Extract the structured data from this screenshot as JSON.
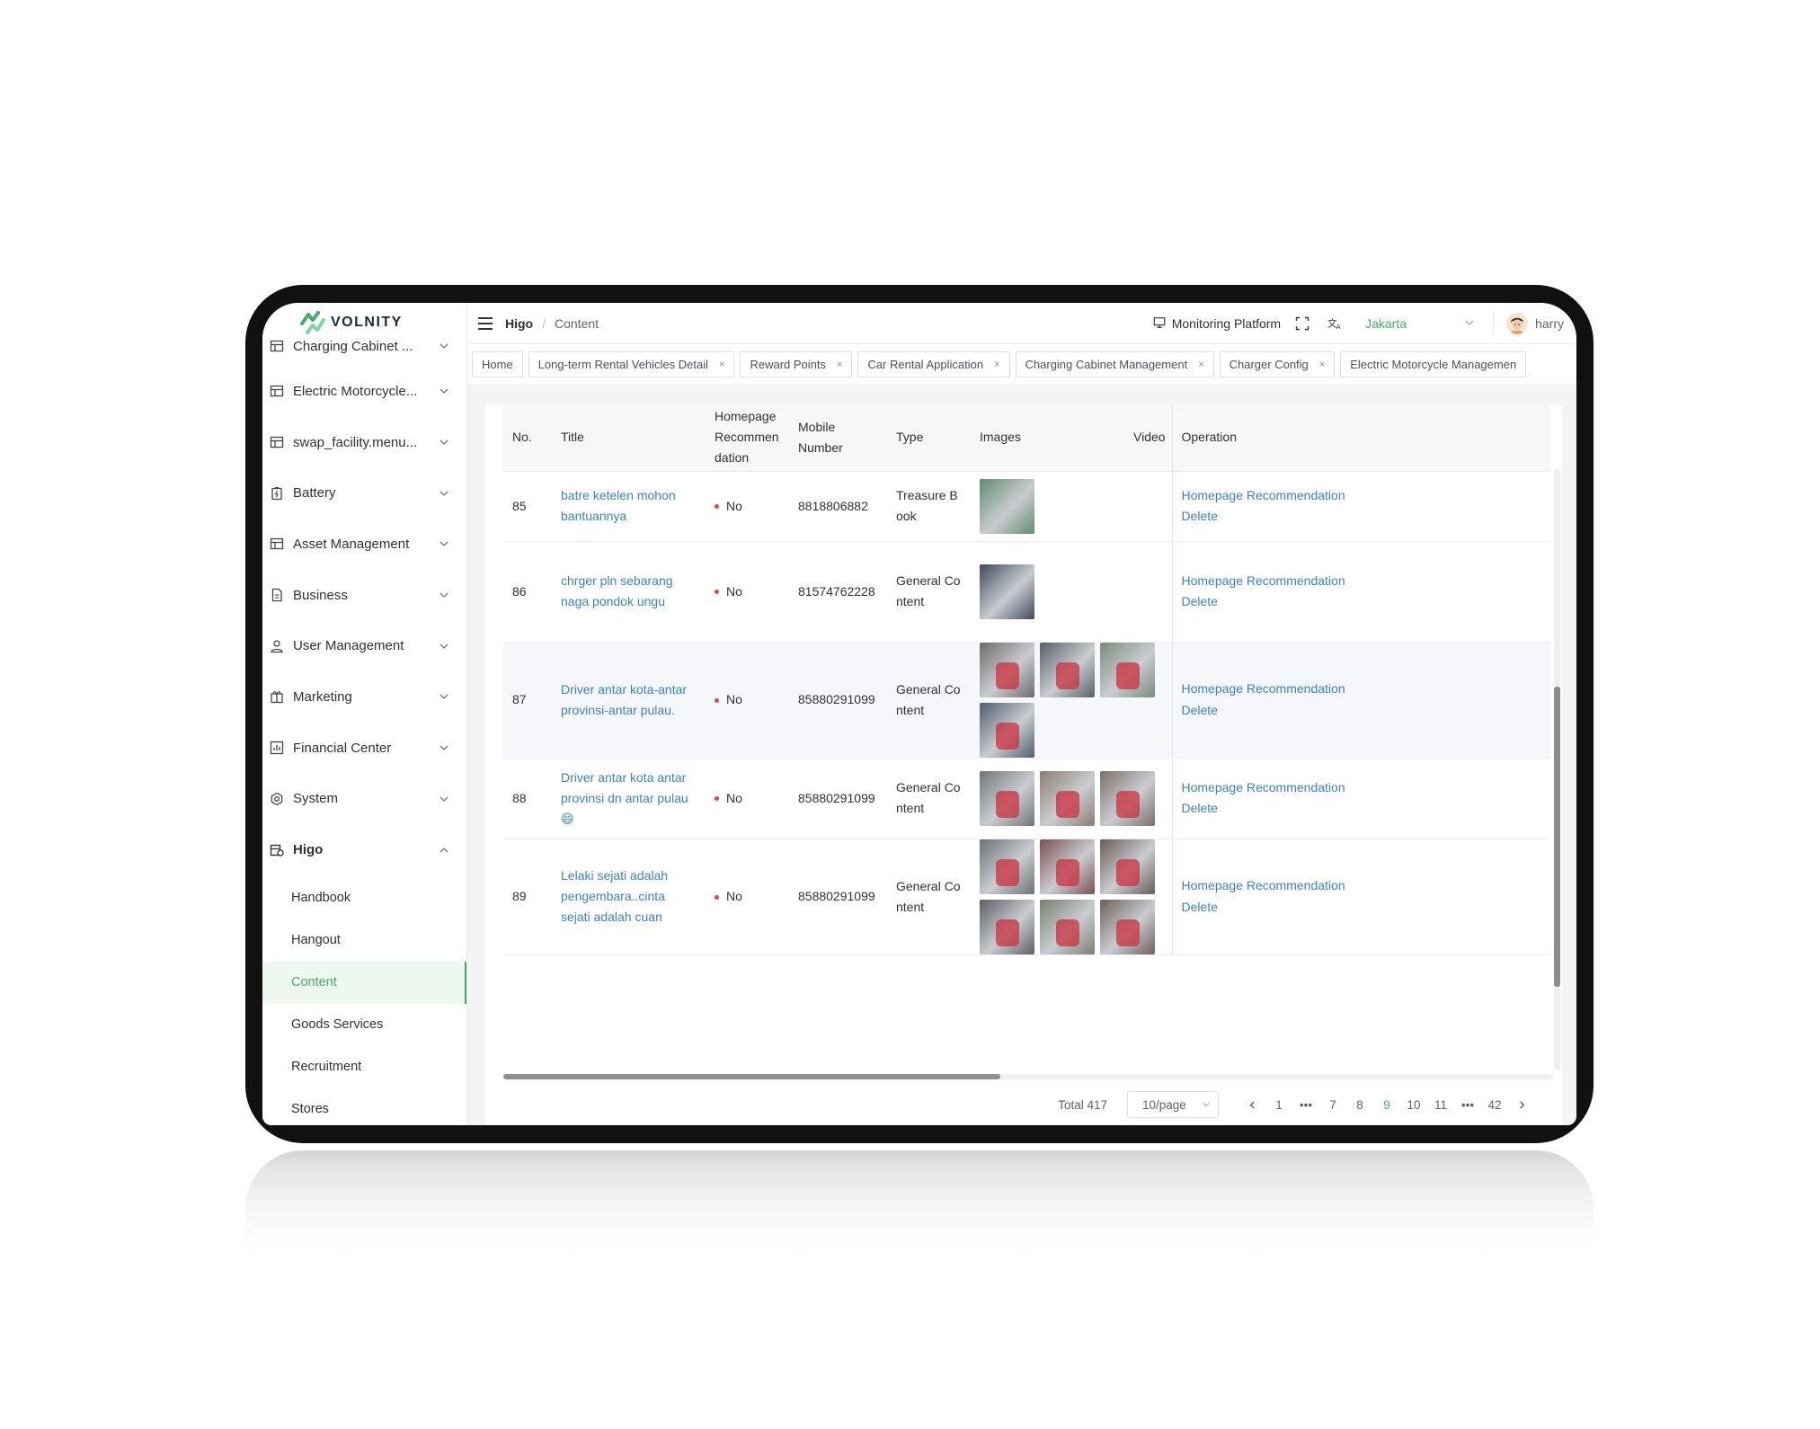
{
  "app": {
    "logo_text": "VOLNITY",
    "brand_color": "#3fae69",
    "link_color": "#3b82c4"
  },
  "sidebar": {
    "items": [
      {
        "label": "Charging Cabinet ...",
        "icon": "grid-icon"
      },
      {
        "label": "Electric Motorcycle...",
        "icon": "grid-icon"
      },
      {
        "label": "swap_facility.menu...",
        "icon": "grid-icon"
      },
      {
        "label": "Battery",
        "icon": "battery-icon"
      },
      {
        "label": "Asset Management",
        "icon": "grid-icon"
      },
      {
        "label": "Business",
        "icon": "document-icon"
      },
      {
        "label": "User Management",
        "icon": "user-icon"
      },
      {
        "label": "Marketing",
        "icon": "gift-icon"
      },
      {
        "label": "Financial Center",
        "icon": "chart-icon"
      },
      {
        "label": "System",
        "icon": "settings-icon"
      },
      {
        "label": "Higo",
        "icon": "higo-icon"
      }
    ],
    "higo_children": [
      "Handbook",
      "Hangout",
      "Content",
      "Goods Services",
      "Recruitment",
      "Stores"
    ],
    "active_child": "Content"
  },
  "topbar": {
    "breadcrumb": [
      "Higo",
      "Content"
    ],
    "monitoring": "Monitoring Platform",
    "city": "Jakarta",
    "user": "harry"
  },
  "tags": [
    {
      "label": "Home",
      "closable": false
    },
    {
      "label": "Long-term Rental Vehicles Detail",
      "closable": true
    },
    {
      "label": "Reward Points",
      "closable": true
    },
    {
      "label": "Car Rental Application",
      "closable": true
    },
    {
      "label": "Charging Cabinet Management",
      "closable": true
    },
    {
      "label": "Charger Config",
      "closable": true
    },
    {
      "label": "Electric Motorcycle Managemen",
      "closable": false
    }
  ],
  "table": {
    "columns": {
      "no": "No.",
      "title": "Title",
      "homepage": "Homepage Recommendation",
      "mobile": "Mobile Number",
      "type": "Type",
      "images": "Images",
      "video": "Video",
      "operation": "Operation"
    },
    "operations": [
      "Homepage Recommendation",
      "Delete"
    ],
    "rows": [
      {
        "no": "85",
        "title": "batre ketelen mohon bantuannya",
        "homepage": "No",
        "mobile": "8818806882",
        "type": "Treasure Book",
        "images": [
          "#5f8c6e"
        ]
      },
      {
        "no": "86",
        "title": "chrger pln sebarang naga pondok ungu",
        "homepage": "No",
        "mobile": "81574762228",
        "type": "General Content",
        "images": [
          "#3e4a5c"
        ]
      },
      {
        "no": "87",
        "title": "Driver antar kota-antar provinsi-antar pulau.",
        "homepage": "No",
        "mobile": "85880291099",
        "type": "General Content",
        "images": [
          "#6d6a6b",
          "#595f68",
          "#7a8c7b",
          "#4f5e6e"
        ]
      },
      {
        "no": "88",
        "title": "Driver antar kota antar provinsi dn antar pulau😄",
        "homepage": "No",
        "mobile": "85880291099",
        "type": "General Content",
        "images": [
          "#6f767c",
          "#8c7d74",
          "#7d6f69"
        ]
      },
      {
        "no": "89",
        "title": "Lelaki sejati adalah pengembara..cinta sejati adalah cuan",
        "homepage": "No",
        "mobile": "85880291099",
        "type": "General Content",
        "images": [
          "#6c7278",
          "#7b4f52",
          "#6a5d55",
          "#5c6167",
          "#7a7f70",
          "#6e5f5c"
        ]
      }
    ]
  },
  "pagination": {
    "total": "Total 417",
    "page_size": "10/page",
    "pages": [
      "1",
      "•••",
      "7",
      "8",
      "9",
      "10",
      "11",
      "•••",
      "42"
    ],
    "current": "9"
  }
}
